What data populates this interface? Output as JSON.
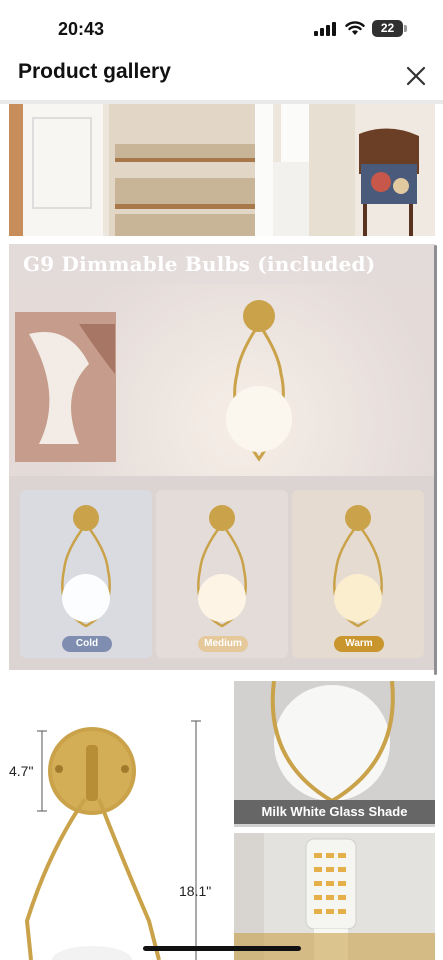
{
  "status_bar": {
    "time": "20:43",
    "battery": "22"
  },
  "header": {
    "title": "Product gallery"
  },
  "gallery": {
    "banner": "G9 Dimmable Bulbs (included)",
    "color_modes": [
      {
        "label": "Cold",
        "color": "#7f8db0"
      },
      {
        "label": "Medium",
        "color": "#e6c99b"
      },
      {
        "label": "Warm",
        "color": "#c9952d"
      }
    ],
    "dimensions": {
      "height_backplate": "4.7\"",
      "height_total": "18.1\""
    },
    "shade_label": "Milk White Glass Shade"
  },
  "colors": {
    "gold": "#c9a24a",
    "background": "#ffffff"
  }
}
